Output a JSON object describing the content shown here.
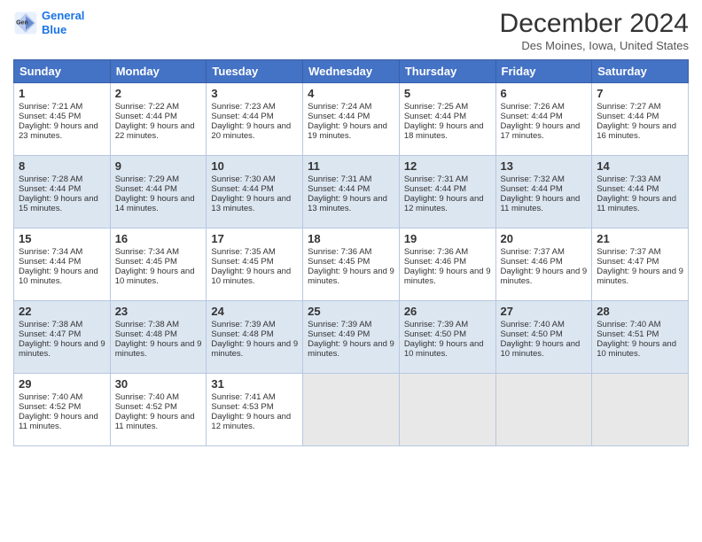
{
  "header": {
    "logo_line1": "General",
    "logo_line2": "Blue",
    "title": "December 2024",
    "location": "Des Moines, Iowa, United States"
  },
  "days_of_week": [
    "Sunday",
    "Monday",
    "Tuesday",
    "Wednesday",
    "Thursday",
    "Friday",
    "Saturday"
  ],
  "weeks": [
    [
      {
        "day": 1,
        "sunrise": "Sunrise: 7:21 AM",
        "sunset": "Sunset: 4:45 PM",
        "daylight": "Daylight: 9 hours and 23 minutes."
      },
      {
        "day": 2,
        "sunrise": "Sunrise: 7:22 AM",
        "sunset": "Sunset: 4:44 PM",
        "daylight": "Daylight: 9 hours and 22 minutes."
      },
      {
        "day": 3,
        "sunrise": "Sunrise: 7:23 AM",
        "sunset": "Sunset: 4:44 PM",
        "daylight": "Daylight: 9 hours and 20 minutes."
      },
      {
        "day": 4,
        "sunrise": "Sunrise: 7:24 AM",
        "sunset": "Sunset: 4:44 PM",
        "daylight": "Daylight: 9 hours and 19 minutes."
      },
      {
        "day": 5,
        "sunrise": "Sunrise: 7:25 AM",
        "sunset": "Sunset: 4:44 PM",
        "daylight": "Daylight: 9 hours and 18 minutes."
      },
      {
        "day": 6,
        "sunrise": "Sunrise: 7:26 AM",
        "sunset": "Sunset: 4:44 PM",
        "daylight": "Daylight: 9 hours and 17 minutes."
      },
      {
        "day": 7,
        "sunrise": "Sunrise: 7:27 AM",
        "sunset": "Sunset: 4:44 PM",
        "daylight": "Daylight: 9 hours and 16 minutes."
      }
    ],
    [
      {
        "day": 8,
        "sunrise": "Sunrise: 7:28 AM",
        "sunset": "Sunset: 4:44 PM",
        "daylight": "Daylight: 9 hours and 15 minutes."
      },
      {
        "day": 9,
        "sunrise": "Sunrise: 7:29 AM",
        "sunset": "Sunset: 4:44 PM",
        "daylight": "Daylight: 9 hours and 14 minutes."
      },
      {
        "day": 10,
        "sunrise": "Sunrise: 7:30 AM",
        "sunset": "Sunset: 4:44 PM",
        "daylight": "Daylight: 9 hours and 13 minutes."
      },
      {
        "day": 11,
        "sunrise": "Sunrise: 7:31 AM",
        "sunset": "Sunset: 4:44 PM",
        "daylight": "Daylight: 9 hours and 13 minutes."
      },
      {
        "day": 12,
        "sunrise": "Sunrise: 7:31 AM",
        "sunset": "Sunset: 4:44 PM",
        "daylight": "Daylight: 9 hours and 12 minutes."
      },
      {
        "day": 13,
        "sunrise": "Sunrise: 7:32 AM",
        "sunset": "Sunset: 4:44 PM",
        "daylight": "Daylight: 9 hours and 11 minutes."
      },
      {
        "day": 14,
        "sunrise": "Sunrise: 7:33 AM",
        "sunset": "Sunset: 4:44 PM",
        "daylight": "Daylight: 9 hours and 11 minutes."
      }
    ],
    [
      {
        "day": 15,
        "sunrise": "Sunrise: 7:34 AM",
        "sunset": "Sunset: 4:44 PM",
        "daylight": "Daylight: 9 hours and 10 minutes."
      },
      {
        "day": 16,
        "sunrise": "Sunrise: 7:34 AM",
        "sunset": "Sunset: 4:45 PM",
        "daylight": "Daylight: 9 hours and 10 minutes."
      },
      {
        "day": 17,
        "sunrise": "Sunrise: 7:35 AM",
        "sunset": "Sunset: 4:45 PM",
        "daylight": "Daylight: 9 hours and 10 minutes."
      },
      {
        "day": 18,
        "sunrise": "Sunrise: 7:36 AM",
        "sunset": "Sunset: 4:45 PM",
        "daylight": "Daylight: 9 hours and 9 minutes."
      },
      {
        "day": 19,
        "sunrise": "Sunrise: 7:36 AM",
        "sunset": "Sunset: 4:46 PM",
        "daylight": "Daylight: 9 hours and 9 minutes."
      },
      {
        "day": 20,
        "sunrise": "Sunrise: 7:37 AM",
        "sunset": "Sunset: 4:46 PM",
        "daylight": "Daylight: 9 hours and 9 minutes."
      },
      {
        "day": 21,
        "sunrise": "Sunrise: 7:37 AM",
        "sunset": "Sunset: 4:47 PM",
        "daylight": "Daylight: 9 hours and 9 minutes."
      }
    ],
    [
      {
        "day": 22,
        "sunrise": "Sunrise: 7:38 AM",
        "sunset": "Sunset: 4:47 PM",
        "daylight": "Daylight: 9 hours and 9 minutes."
      },
      {
        "day": 23,
        "sunrise": "Sunrise: 7:38 AM",
        "sunset": "Sunset: 4:48 PM",
        "daylight": "Daylight: 9 hours and 9 minutes."
      },
      {
        "day": 24,
        "sunrise": "Sunrise: 7:39 AM",
        "sunset": "Sunset: 4:48 PM",
        "daylight": "Daylight: 9 hours and 9 minutes."
      },
      {
        "day": 25,
        "sunrise": "Sunrise: 7:39 AM",
        "sunset": "Sunset: 4:49 PM",
        "daylight": "Daylight: 9 hours and 9 minutes."
      },
      {
        "day": 26,
        "sunrise": "Sunrise: 7:39 AM",
        "sunset": "Sunset: 4:50 PM",
        "daylight": "Daylight: 9 hours and 10 minutes."
      },
      {
        "day": 27,
        "sunrise": "Sunrise: 7:40 AM",
        "sunset": "Sunset: 4:50 PM",
        "daylight": "Daylight: 9 hours and 10 minutes."
      },
      {
        "day": 28,
        "sunrise": "Sunrise: 7:40 AM",
        "sunset": "Sunset: 4:51 PM",
        "daylight": "Daylight: 9 hours and 10 minutes."
      }
    ],
    [
      {
        "day": 29,
        "sunrise": "Sunrise: 7:40 AM",
        "sunset": "Sunset: 4:52 PM",
        "daylight": "Daylight: 9 hours and 11 minutes."
      },
      {
        "day": 30,
        "sunrise": "Sunrise: 7:40 AM",
        "sunset": "Sunset: 4:52 PM",
        "daylight": "Daylight: 9 hours and 11 minutes."
      },
      {
        "day": 31,
        "sunrise": "Sunrise: 7:41 AM",
        "sunset": "Sunset: 4:53 PM",
        "daylight": "Daylight: 9 hours and 12 minutes."
      },
      null,
      null,
      null,
      null
    ]
  ]
}
